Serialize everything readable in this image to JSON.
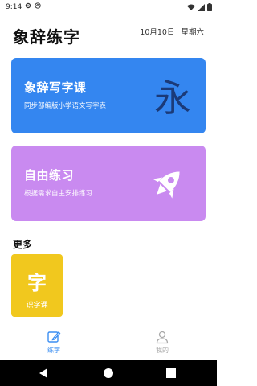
{
  "status_bar": {
    "time": "9:14"
  },
  "header": {
    "title": "象辞练字",
    "date": "10月10日",
    "weekday": "星期六"
  },
  "cards": [
    {
      "title": "象辞写字课",
      "subtitle": "同步部编版小学语文写字表",
      "glyph": "永",
      "color": "#3486f0"
    },
    {
      "title": "自由练习",
      "subtitle": "根据需求自主安排练习",
      "icon": "rocket-icon",
      "color": "#c98af0"
    }
  ],
  "more": {
    "title": "更多",
    "tiles": [
      {
        "glyph": "字",
        "label": "识字课",
        "color": "#f1c81e"
      }
    ]
  },
  "tabs": [
    {
      "label": "练字",
      "icon": "pen-edit-icon",
      "active": true,
      "color": "#3b8ef2"
    },
    {
      "label": "我的",
      "icon": "person-icon",
      "active": false,
      "color": "#a9a9a9"
    }
  ],
  "system_nav": {
    "back_icon": "back-triangle-icon",
    "home_icon": "home-circle-icon",
    "recents_icon": "recents-square-icon"
  }
}
